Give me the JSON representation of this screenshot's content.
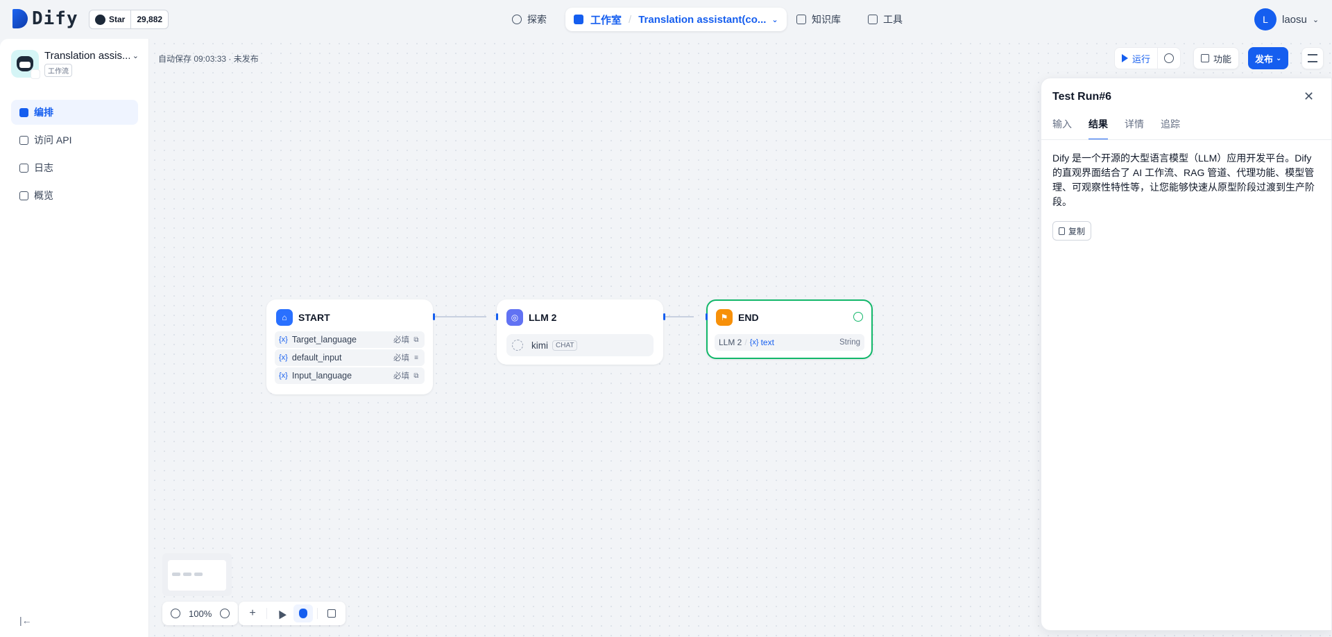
{
  "header": {
    "logo_text": "Dify",
    "github": {
      "star_label": "Star",
      "star_count": "29,882"
    },
    "nav": {
      "explore": "探索",
      "studio": "工作室",
      "app_breadcrumb": "Translation assistant(co...",
      "knowledge": "知识库",
      "tools": "工具"
    },
    "user": {
      "initial": "L",
      "name": "laosu"
    }
  },
  "sidebar": {
    "app_name": "Translation assis...",
    "app_type": "工作流",
    "items": [
      {
        "label": "编排",
        "icon": "orchestrate-icon",
        "active": true
      },
      {
        "label": "访问 API",
        "icon": "terminal-icon",
        "active": false
      },
      {
        "label": "日志",
        "icon": "log-icon",
        "active": false
      },
      {
        "label": "概览",
        "icon": "chart-icon",
        "active": false
      }
    ]
  },
  "canvas": {
    "autosave": "自动保存 09:03:33 · 未发布",
    "run_label": "运行",
    "features_label": "功能",
    "publish_label": "发布",
    "zoom": "100%"
  },
  "nodes": {
    "start": {
      "title": "START",
      "vars": [
        {
          "name": "Target_language",
          "required": "必填",
          "type_icon": "select-icon"
        },
        {
          "name": "default_input",
          "required": "必填",
          "type_icon": "paragraph-icon"
        },
        {
          "name": "Input_language",
          "required": "必填",
          "type_icon": "select-icon"
        }
      ]
    },
    "llm": {
      "title": "LLM 2",
      "model": "kimi",
      "mode": "CHAT"
    },
    "end": {
      "title": "END",
      "source": "LLM 2",
      "var": "text",
      "type": "String"
    }
  },
  "panel": {
    "title": "Test Run#6",
    "tabs": [
      "输入",
      "结果",
      "详情",
      "追踪"
    ],
    "active_tab": 1,
    "result_text": "Dify 是一个开源的大型语言模型（LLM）应用开发平台。Dify 的直观界面结合了 AI 工作流、RAG 管道、代理功能、模型管理、可观察性特性等，让您能够快速从原型阶段过渡到生产阶段。",
    "copy_label": "复制"
  },
  "colors": {
    "accent": "#155eef",
    "start": "#2970ff",
    "llm": "#6172f3",
    "end": "#f79009",
    "success": "#12b76a"
  }
}
